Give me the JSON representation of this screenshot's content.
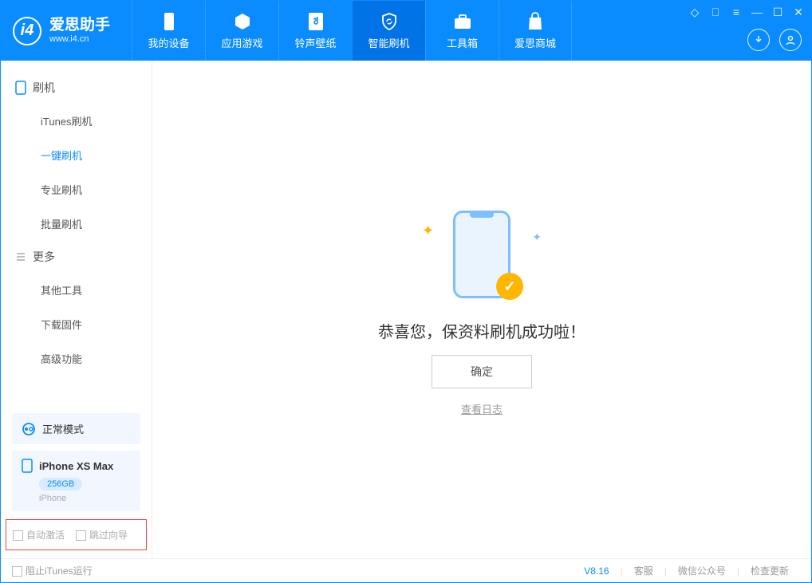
{
  "app": {
    "title": "爱思助手",
    "url": "www.i4.cn"
  },
  "nav": {
    "tabs": [
      {
        "label": "我的设备"
      },
      {
        "label": "应用游戏"
      },
      {
        "label": "铃声壁纸"
      },
      {
        "label": "智能刷机"
      },
      {
        "label": "工具箱"
      },
      {
        "label": "爱思商城"
      }
    ]
  },
  "sidebar": {
    "section1": {
      "title": "刷机",
      "items": [
        "iTunes刷机",
        "一键刷机",
        "专业刷机",
        "批量刷机"
      ]
    },
    "section2": {
      "title": "更多",
      "items": [
        "其他工具",
        "下载固件",
        "高级功能"
      ]
    },
    "mode": "正常模式",
    "device": {
      "name": "iPhone XS Max",
      "storage": "256GB",
      "type": "iPhone"
    },
    "checkbox1": "自动激活",
    "checkbox2": "跳过向导"
  },
  "main": {
    "success": "恭喜您，保资料刷机成功啦！",
    "ok": "确定",
    "viewlog": "查看日志"
  },
  "footer": {
    "block_itunes": "阻止iTunes运行",
    "version": "V8.16",
    "support": "客服",
    "wechat": "微信公众号",
    "update": "检查更新"
  }
}
